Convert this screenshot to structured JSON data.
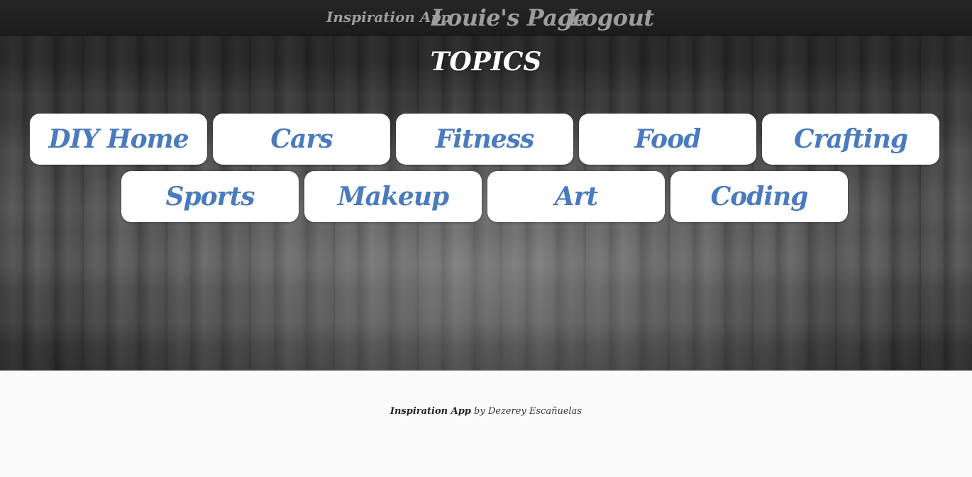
{
  "navbar": {
    "brand": "Inspiration App",
    "user_link": "Louie's Page",
    "logout": "Logout"
  },
  "page_title": "TOPICS",
  "topics": [
    {
      "label": "DIY Home"
    },
    {
      "label": "Cars"
    },
    {
      "label": "Fitness"
    },
    {
      "label": "Food"
    },
    {
      "label": "Crafting"
    },
    {
      "label": "Sports"
    },
    {
      "label": "Makeup"
    },
    {
      "label": "Art"
    },
    {
      "label": "Coding"
    }
  ],
  "footer": {
    "app_name": "Inspiration App",
    "by_text": "by Dezerey Escañuelas"
  },
  "colors": {
    "navbar_bg": "#222222",
    "nav_text": "#9d9d9d",
    "topic_text": "#4a7bbf",
    "topic_bg": "#ffffff",
    "footer_bg": "#fafafa"
  }
}
